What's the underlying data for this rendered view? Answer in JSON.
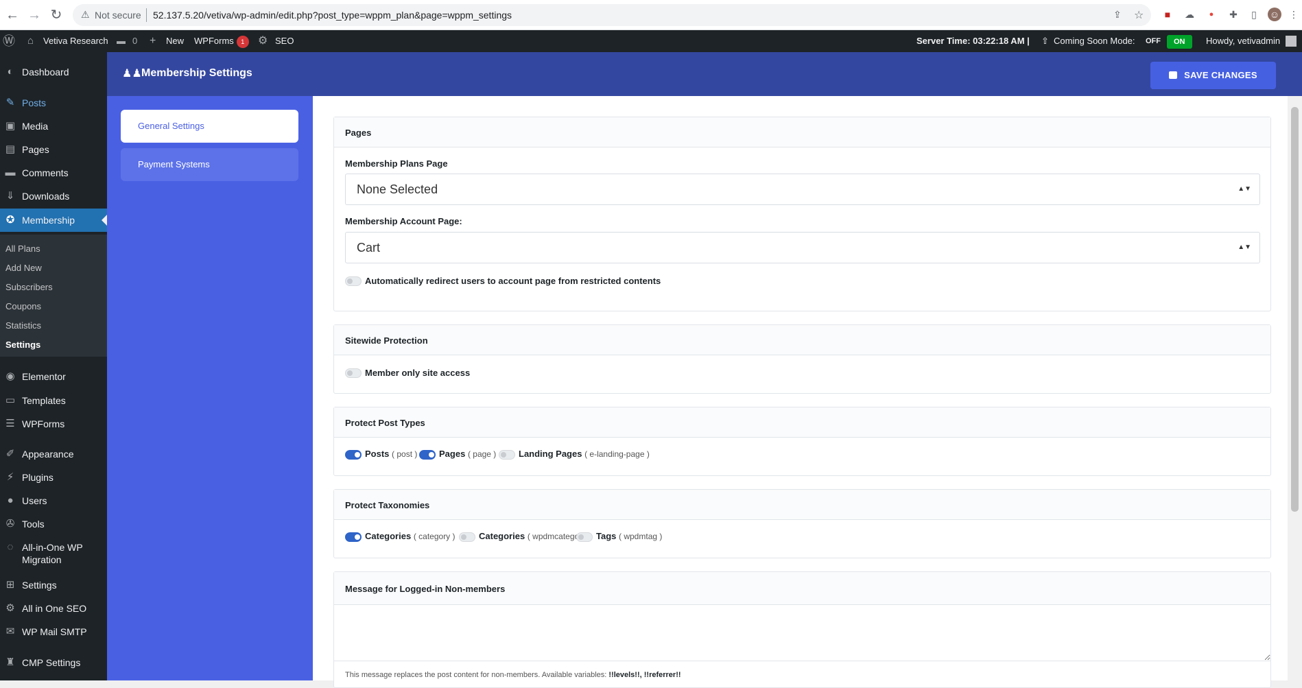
{
  "browser": {
    "security_label": "Not secure",
    "url": "52.137.5.20/vetiva/wp-admin/edit.php?post_type=wppm_plan&page=wppm_settings"
  },
  "admin_bar": {
    "site_name": "Vetiva Research",
    "comments_count": "0",
    "new_label": "New",
    "wpforms_label": "WPForms",
    "wpforms_badge": "1",
    "seo_label": "SEO",
    "server_time": "Server Time: 03:22:18 AM |",
    "coming_soon_label": "Coming Soon Mode:",
    "off_label": "OFF",
    "on_label": "ON",
    "howdy": "Howdy, vetivadmin"
  },
  "sidebar": {
    "items": [
      {
        "label": "Dashboard",
        "icon": "dashboard-icon"
      },
      {
        "label": "Posts",
        "icon": "pin-icon"
      },
      {
        "label": "Media",
        "icon": "media-icon"
      },
      {
        "label": "Pages",
        "icon": "page-icon"
      },
      {
        "label": "Comments",
        "icon": "comment-icon"
      },
      {
        "label": "Downloads",
        "icon": "download-icon"
      },
      {
        "label": "Membership",
        "icon": "award-icon"
      },
      {
        "label": "Elementor",
        "icon": "elementor-icon"
      },
      {
        "label": "Templates",
        "icon": "folder-icon"
      },
      {
        "label": "WPForms",
        "icon": "form-icon"
      },
      {
        "label": "Appearance",
        "icon": "brush-icon"
      },
      {
        "label": "Plugins",
        "icon": "plugin-icon"
      },
      {
        "label": "Users",
        "icon": "user-icon"
      },
      {
        "label": "Tools",
        "icon": "wrench-icon"
      },
      {
        "label": "All-in-One WP",
        "label2": "Migration",
        "icon": "migration-icon"
      },
      {
        "label": "Settings",
        "icon": "settings-icon"
      },
      {
        "label": "All in One SEO",
        "icon": "seo-icon"
      },
      {
        "label": "WP Mail SMTP",
        "icon": "mail-icon"
      },
      {
        "label": "CMP Settings",
        "icon": "cmp-icon"
      }
    ],
    "submenu": [
      "All Plans",
      "Add New",
      "Subscribers",
      "Coupons",
      "Statistics",
      "Settings"
    ]
  },
  "header": {
    "title": "Membership Settings",
    "save_label": "SAVE CHANGES"
  },
  "tabs": [
    "General Settings",
    "Payment Systems"
  ],
  "pages_panel": {
    "title": "Pages",
    "plans_label": "Membership Plans Page",
    "plans_value": "None Selected",
    "account_label": "Membership Account Page:",
    "account_value": "Cart",
    "redirect_label": "Automatically redirect users to account page from restricted contents"
  },
  "sitewide_panel": {
    "title": "Sitewide Protection",
    "member_only_label": "Member only site access"
  },
  "post_types_panel": {
    "title": "Protect Post Types",
    "items": [
      {
        "label": "Posts",
        "slug": "( post )",
        "on": true
      },
      {
        "label": "Pages",
        "slug": "( page )",
        "on": true
      },
      {
        "label": "Landing Pages",
        "slug": "( e-landing-page )",
        "on": false
      }
    ]
  },
  "taxonomies_panel": {
    "title": "Protect Taxonomies",
    "items": [
      {
        "label": "Categories",
        "slug": "( category )",
        "on": true
      },
      {
        "label": "Categories",
        "slug": "( wpdmcategory )",
        "on": false
      },
      {
        "label": "Tags",
        "slug": "( wpdmtag )",
        "on": false
      }
    ]
  },
  "message_panel": {
    "title": "Message for Logged-in Non-members",
    "hint_prefix": "This message replaces the post content for non-members. Available variables:",
    "hint_vars": "!!levels!!, !!referrer!!"
  }
}
